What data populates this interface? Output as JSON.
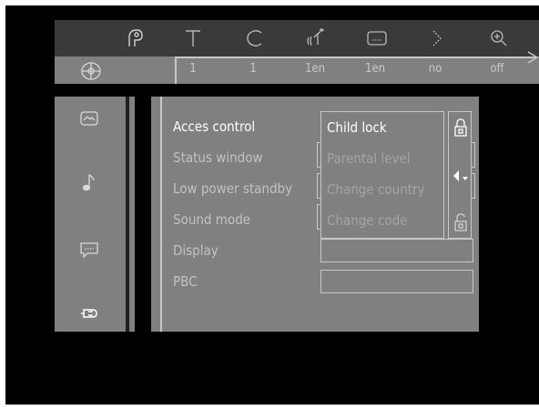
{
  "topbar": {
    "icons": [
      {
        "name": "angle-icon"
      },
      {
        "name": "title-icon",
        "glyph": "T"
      },
      {
        "name": "chapter-icon",
        "glyph": "C"
      },
      {
        "name": "audio-language-icon"
      },
      {
        "name": "subtitle-icon"
      },
      {
        "name": "step-icon"
      },
      {
        "name": "zoom-icon"
      }
    ],
    "values": [
      "1",
      "1",
      "1en",
      "1en",
      "no",
      "off"
    ]
  },
  "sidebar": {
    "items": [
      {
        "name": "picture-settings-icon"
      },
      {
        "name": "sound-settings-icon"
      },
      {
        "name": "language-settings-icon"
      },
      {
        "name": "features-settings-icon"
      }
    ]
  },
  "menu": {
    "items": [
      {
        "label": "Acces control",
        "active": true
      },
      {
        "label": "Status window",
        "active": false
      },
      {
        "label": "Low power standby",
        "active": false
      },
      {
        "label": "Sound mode",
        "active": false
      },
      {
        "label": "Display",
        "active": false
      },
      {
        "label": "PBC",
        "active": false
      }
    ]
  },
  "submenu": {
    "items": [
      {
        "label": "Child lock",
        "active": true
      },
      {
        "label": "Parental level",
        "active": false
      },
      {
        "label": "Change country",
        "active": false
      },
      {
        "label": "Change code",
        "active": false
      }
    ]
  },
  "colors": {
    "screen_bg": "#000000",
    "panel_bg": "#808080",
    "icon_bar_bg": "#3a3a3a",
    "text_active": "#ffffff",
    "text_inactive": "#c2c2c2"
  }
}
